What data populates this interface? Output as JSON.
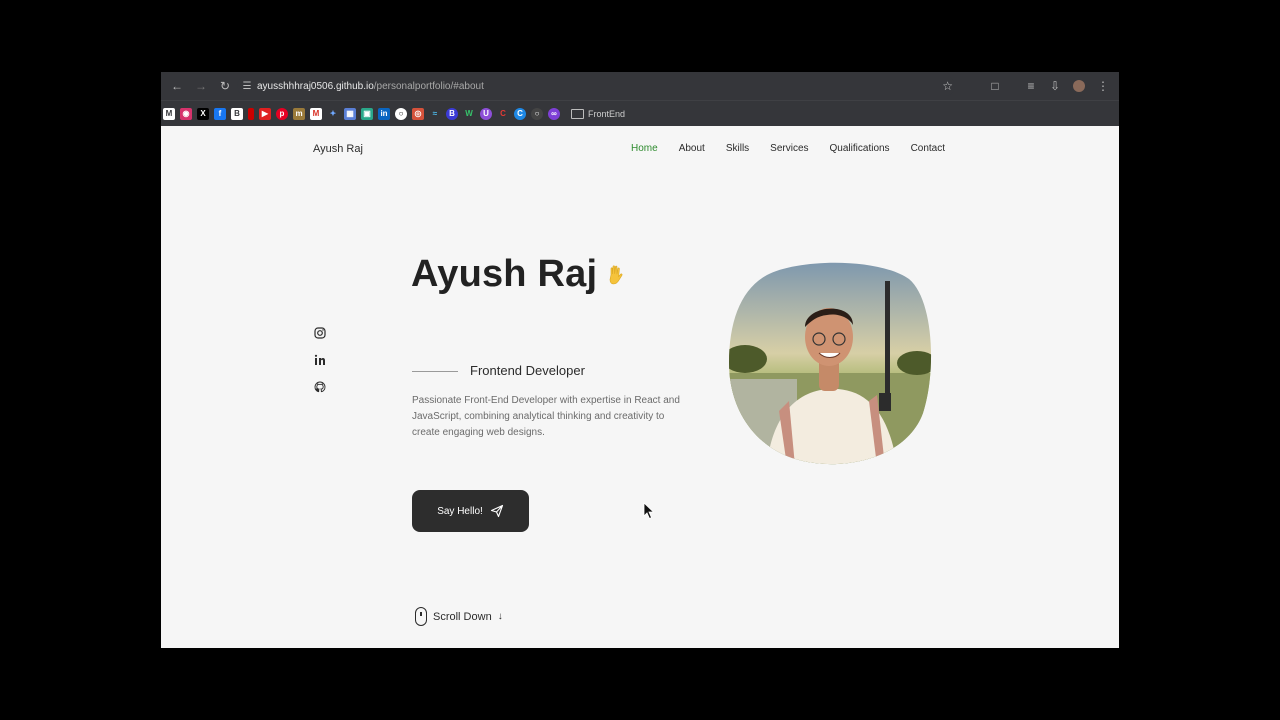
{
  "browser": {
    "url_host": "ayusshhhraj0506.github.io",
    "url_path": "/personalportfolio/#about",
    "bookmark_folder": "FrontEnd",
    "bookmark_icons": [
      "linkedin-icon",
      "instagram-icon",
      "x-icon",
      "facebook-icon",
      "bookmark-icon",
      "red-icon",
      "youtube-icon",
      "pinterest-icon",
      "misc-icon",
      "gmail-icon",
      "plus-icon",
      "grid-icon",
      "bag-icon",
      "linkedin-icon",
      "github-icon",
      "chrome-icon",
      "cloud-icon",
      "b-icon",
      "w-icon",
      "u-icon",
      "red-c-icon",
      "c-icon",
      "circle-icon",
      "purple-icon"
    ]
  },
  "nav": {
    "logo": "Ayush Raj",
    "links": [
      "Home",
      "About",
      "Skills",
      "Services",
      "Qualifications",
      "Contact"
    ],
    "active": "Home"
  },
  "hero": {
    "name": "Ayush Raj",
    "subtitle": "Frontend Developer",
    "description": "Passionate Front-End Developer with expertise in React and JavaScript, combining analytical thinking and creativity to create engaging web designs.",
    "cta_label": "Say Hello!",
    "scroll_label": "Scroll Down"
  },
  "colors": {
    "accent": "#2e8b2e",
    "button": "#2d2d2d",
    "page_bg": "#f6f6f6"
  }
}
